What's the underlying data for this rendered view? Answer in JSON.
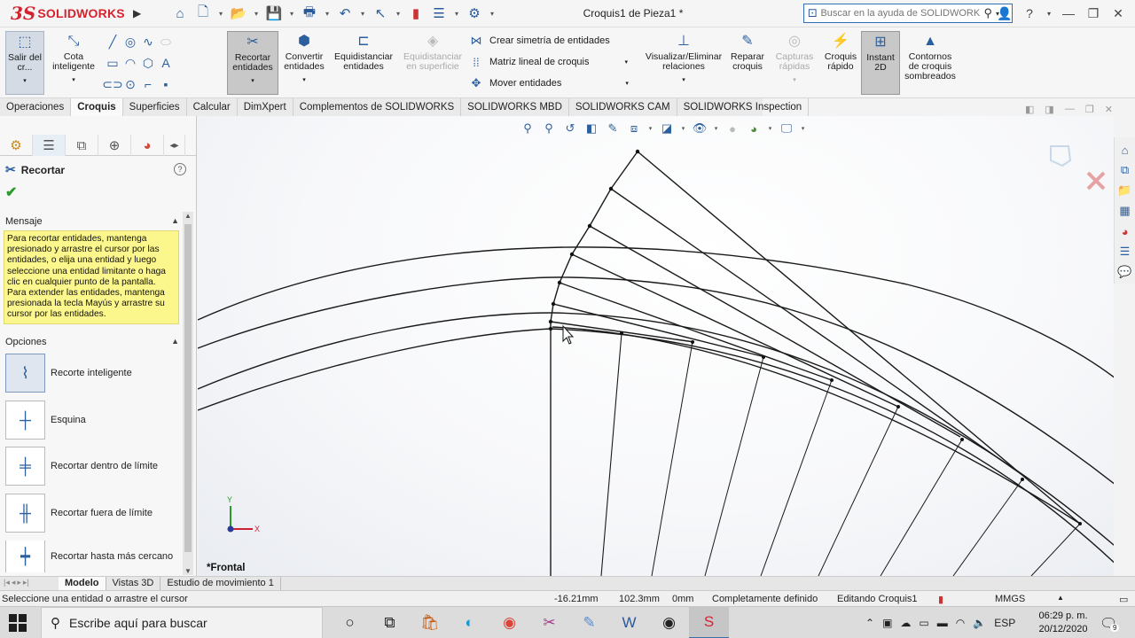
{
  "app": {
    "brand": "SOLIDWORKS",
    "brand_mark": "3S",
    "document_title": "Croquis1 de Pieza1 *",
    "help_search_placeholder": "Buscar en la ayuda de SOLIDWORKS"
  },
  "ribbon": {
    "exit_sketch": "Salir del cr...",
    "smart_dimension": "Cota inteligente",
    "trim_entities": "Recortar entidades",
    "convert_entities": "Convertir entidades",
    "offset_entities": "Equidistanciar entidades",
    "offset_on_surface": "Equidistanciar en superficie",
    "mirror_entities": "Crear simetría de entidades",
    "linear_pattern": "Matriz lineal de croquis",
    "move_entities": "Mover entidades",
    "display_relations": "Visualizar/Eliminar relaciones",
    "repair_sketch": "Reparar croquis",
    "quick_snaps": "Capturas rápidas",
    "rapid_sketch": "Croquis rápido",
    "instant_2d": "Instant 2D",
    "shaded_contours": "Contornos de croquis sombreados"
  },
  "command_tabs": [
    {
      "label": "Operaciones"
    },
    {
      "label": "Croquis"
    },
    {
      "label": "Superficies"
    },
    {
      "label": "Calcular"
    },
    {
      "label": "DimXpert"
    },
    {
      "label": "Complementos de SOLIDWORKS"
    },
    {
      "label": "SOLIDWORKS MBD"
    },
    {
      "label": "SOLIDWORKS CAM"
    },
    {
      "label": "SOLIDWORKS Inspection"
    }
  ],
  "property_manager": {
    "title": "Recortar",
    "message_header": "Mensaje",
    "message": "Para recortar entidades, mantenga presionado y arrastre el cursor por las entidades, o elija una entidad y luego seleccione una entidad limitante o haga clic en cualquier punto de la pantalla. Para extender las entidades, mantenga presionada la tecla Mayús y arrastre su cursor por las entidades.",
    "options_header": "Opciones",
    "options": [
      {
        "label": "Recorte inteligente"
      },
      {
        "label": "Esquina"
      },
      {
        "label": "Recortar dentro de límite"
      },
      {
        "label": "Recortar fuera de límite"
      },
      {
        "label": "Recortar hasta más cercano"
      }
    ]
  },
  "viewport": {
    "view_name": "*Frontal",
    "axis_x": "X",
    "axis_y": "Y"
  },
  "bottom_tabs": [
    {
      "label": "Modelo"
    },
    {
      "label": "Vistas 3D"
    },
    {
      "label": "Estudio de movimiento 1"
    }
  ],
  "status": {
    "prompt": "Seleccione una entidad o arrastre el cursor",
    "x": "-16.21mm",
    "y": "102.3mm",
    "z": "0mm",
    "state": "Completamente definido",
    "editing": "Editando Croquis1",
    "units": "MMGS"
  },
  "taskbar": {
    "search_placeholder": "Escribe aquí para buscar",
    "language": "ESP",
    "time": "06:29 p. m.",
    "date": "20/12/2020",
    "notifications": "9"
  },
  "colors": {
    "brand_red": "#d5232f",
    "message_yellow": "#fcf78d",
    "accent_blue": "#2c5f9e"
  }
}
